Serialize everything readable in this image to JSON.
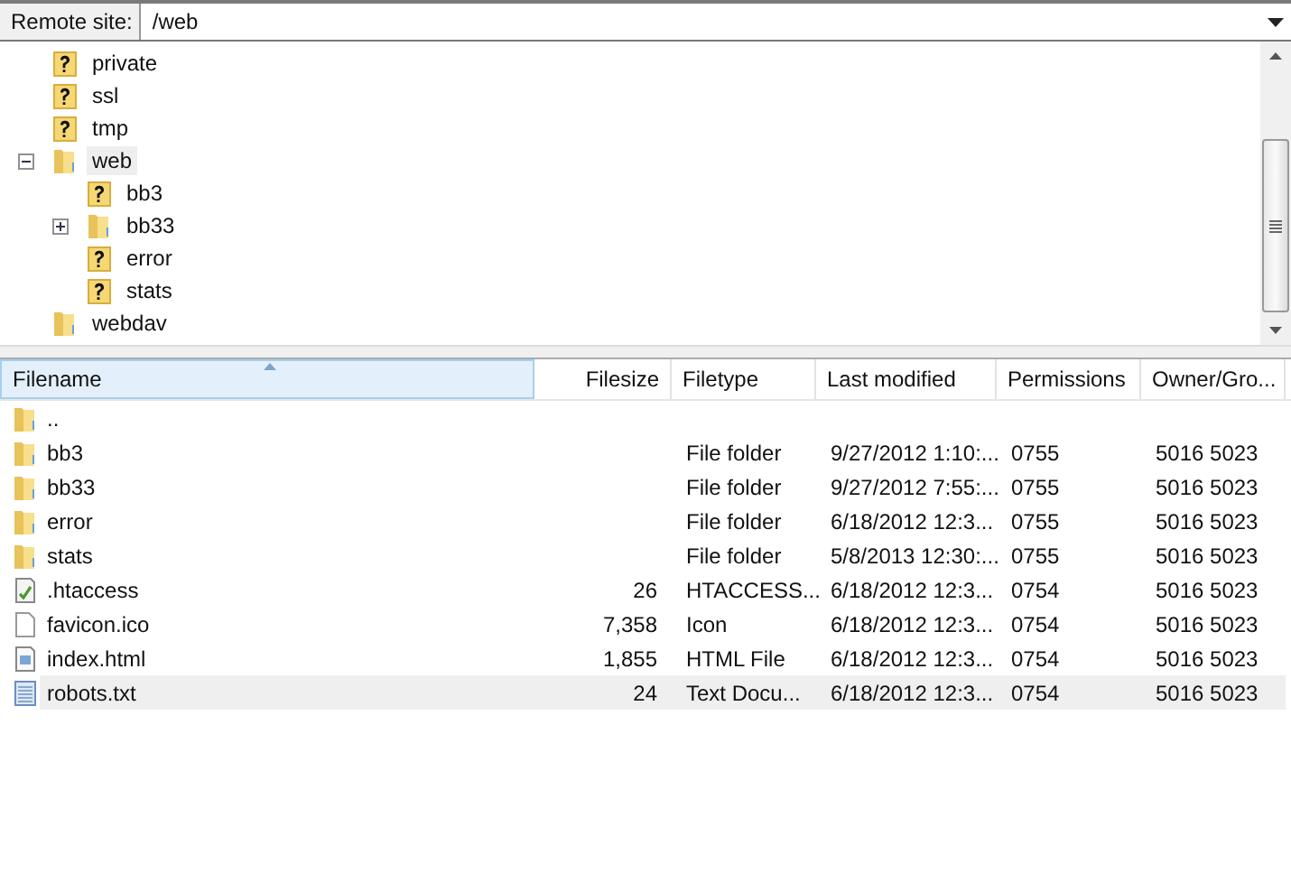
{
  "remote_site": {
    "label": "Remote site:",
    "value": "/web"
  },
  "tree": [
    {
      "name": "private",
      "kind": "unknown",
      "selected": false
    },
    {
      "name": "ssl",
      "kind": "unknown",
      "selected": false
    },
    {
      "name": "tmp",
      "kind": "unknown",
      "selected": false
    },
    {
      "name": "web",
      "kind": "folder",
      "selected": true,
      "expanded": true,
      "children": [
        {
          "name": "bb3",
          "kind": "unknown",
          "selected": false
        },
        {
          "name": "bb33",
          "kind": "folder",
          "selected": false,
          "expanded": false
        },
        {
          "name": "error",
          "kind": "unknown",
          "selected": false
        },
        {
          "name": "stats",
          "kind": "unknown",
          "selected": false
        }
      ]
    },
    {
      "name": "webdav",
      "kind": "folder",
      "selected": false
    }
  ],
  "table": {
    "columns": [
      {
        "label": "Filename",
        "sorted": true
      },
      {
        "label": "Filesize",
        "sorted": false
      },
      {
        "label": "Filetype",
        "sorted": false
      },
      {
        "label": "Last modified",
        "sorted": false
      },
      {
        "label": "Permissions",
        "sorted": false
      },
      {
        "label": "Owner/Gro...",
        "sorted": false
      }
    ],
    "rows": [
      {
        "kind": "folder",
        "selected": false,
        "cells": [
          "..",
          "",
          "",
          "",
          "",
          ""
        ]
      },
      {
        "kind": "folder",
        "selected": false,
        "cells": [
          "bb3",
          "",
          "File folder",
          "9/27/2012 1:10:...",
          "0755",
          "5016 5023"
        ]
      },
      {
        "kind": "folder",
        "selected": false,
        "cells": [
          "bb33",
          "",
          "File folder",
          "9/27/2012 7:55:...",
          "0755",
          "5016 5023"
        ]
      },
      {
        "kind": "folder",
        "selected": false,
        "cells": [
          "error",
          "",
          "File folder",
          "6/18/2012 12:3...",
          "0755",
          "5016 5023"
        ]
      },
      {
        "kind": "folder",
        "selected": false,
        "cells": [
          "stats",
          "",
          "File folder",
          "5/8/2013 12:30:...",
          "0755",
          "5016 5023"
        ]
      },
      {
        "kind": "config",
        "selected": false,
        "cells": [
          ".htaccess",
          "26",
          "HTACCESS...",
          "6/18/2012 12:3...",
          "0754",
          "5016 5023"
        ]
      },
      {
        "kind": "file",
        "selected": false,
        "cells": [
          "favicon.ico",
          "7,358",
          "Icon",
          "6/18/2012 12:3...",
          "0754",
          "5016 5023"
        ]
      },
      {
        "kind": "html",
        "selected": false,
        "cells": [
          "index.html",
          "1,855",
          "HTML File",
          "6/18/2012 12:3...",
          "0754",
          "5016 5023"
        ]
      },
      {
        "kind": "text",
        "selected": true,
        "cells": [
          "robots.txt",
          "24",
          "Text Docu...",
          "6/18/2012 12:3...",
          "0754",
          "5016 5023"
        ]
      }
    ]
  }
}
